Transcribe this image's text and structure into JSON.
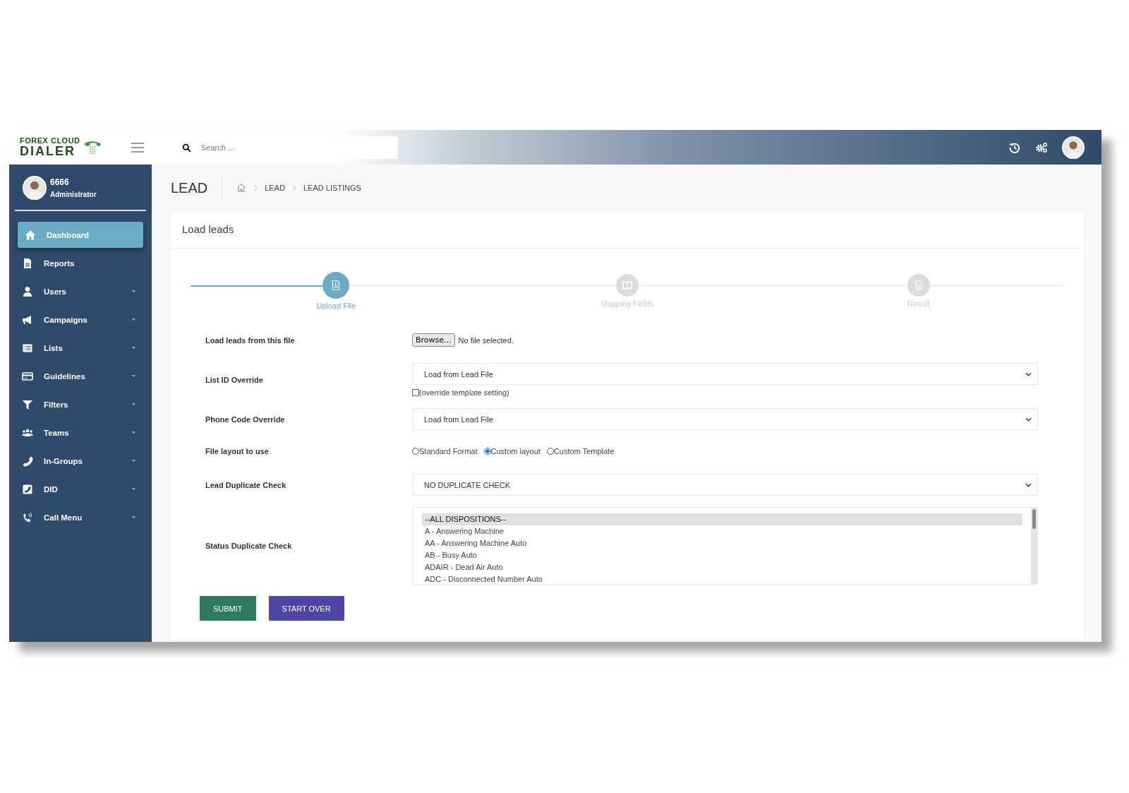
{
  "brand": {
    "line1": "FOREX CLOUD",
    "line2": "DIALER"
  },
  "search": {
    "placeholder": "Search ..."
  },
  "user": {
    "name": "6666",
    "role": "Administrator"
  },
  "sidebar": {
    "items": [
      {
        "label": "Dashboard",
        "selected": true,
        "expandable": false
      },
      {
        "label": "Reports",
        "selected": false,
        "expandable": false
      },
      {
        "label": "Users",
        "selected": false,
        "expandable": true
      },
      {
        "label": "Campaigns",
        "selected": false,
        "expandable": true
      },
      {
        "label": "Lists",
        "selected": false,
        "expandable": true
      },
      {
        "label": "Guidelines",
        "selected": false,
        "expandable": true
      },
      {
        "label": "Filters",
        "selected": false,
        "expandable": true
      },
      {
        "label": "Teams",
        "selected": false,
        "expandable": true
      },
      {
        "label": "In-Groups",
        "selected": false,
        "expandable": true
      },
      {
        "label": "DID",
        "selected": false,
        "expandable": true
      },
      {
        "label": "Call Menu",
        "selected": false,
        "expandable": true
      }
    ]
  },
  "page": {
    "title": "LEAD",
    "breadcrumb": [
      "LEAD",
      "LEAD LISTINGS"
    ]
  },
  "card": {
    "title": "Load leads"
  },
  "steps": [
    {
      "label": "Upload File",
      "selected": true
    },
    {
      "label": "Mapping Fields",
      "selected": false
    },
    {
      "label": "Result",
      "selected": false
    }
  ],
  "form": [
    {
      "kind": "file",
      "label": "Load leads from this file",
      "button": "Browse...",
      "status": "No file selected."
    },
    {
      "kind": "select",
      "label": "List ID Override",
      "value": "Load from Lead File",
      "checkbox": {
        "label": "(override template setting)",
        "checked": false
      }
    },
    {
      "kind": "select",
      "label": "Phone Code Override",
      "value": "Load from Lead File"
    },
    {
      "kind": "radio",
      "label": "File layout to use",
      "options": [
        {
          "label": "Standard Format",
          "selected": false
        },
        {
          "label": "Custom layout",
          "selected": true
        },
        {
          "label": "Custom Template",
          "selected": false
        }
      ]
    },
    {
      "kind": "select",
      "label": "Lead Duplicate Check",
      "value": "NO DUPLICATE CHECK"
    },
    {
      "kind": "listbox",
      "label": "Status Duplicate Check",
      "options": [
        {
          "label": "--ALL DISPOSITIONS--",
          "selected": true
        },
        {
          "label": "A - Answering Machine",
          "selected": false
        },
        {
          "label": "AA - Answering Machine Auto",
          "selected": false
        },
        {
          "label": "AB - Busy Auto",
          "selected": false
        },
        {
          "label": "ADAIR - Dead Air Auto",
          "selected": false
        },
        {
          "label": "ADC - Disconnected Number Auto",
          "selected": false
        }
      ]
    }
  ],
  "buttons": [
    {
      "label": "SUBMIT",
      "kind": "primary"
    },
    {
      "label": "START OVER",
      "kind": "secondary"
    }
  ]
}
